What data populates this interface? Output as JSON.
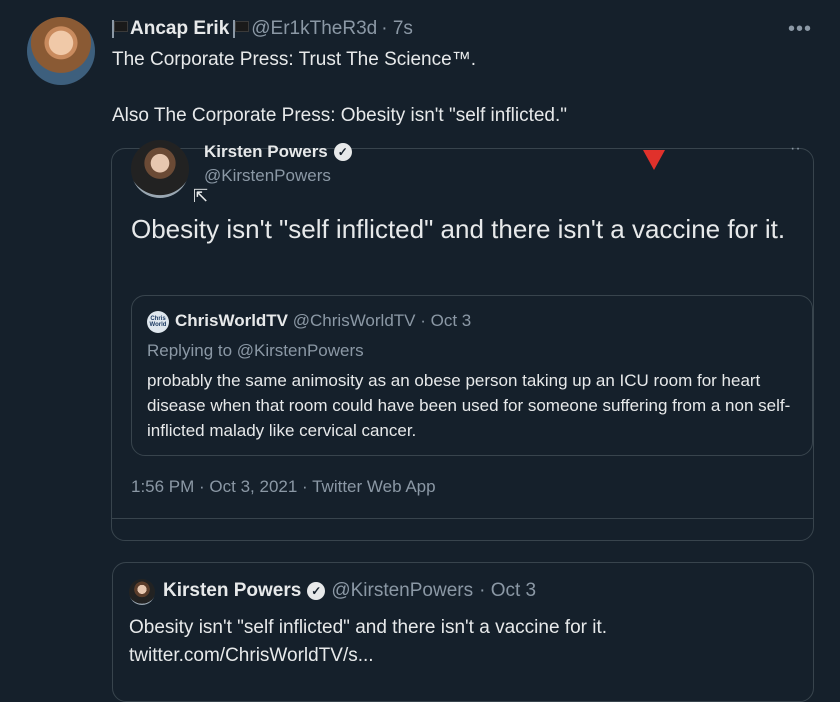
{
  "tweet": {
    "display_name": "Ancap Erik",
    "handle": "@Er1kTheR3d",
    "time": "· 7s",
    "more": "•••",
    "line1": "The Corporate Press: Trust The Science™.",
    "line2": "Also The Corporate Press: Obesity isn't \"self inflicted.\""
  },
  "quoted": {
    "name": "Kirsten Powers",
    "handle": "@KirstenPowers",
    "text": "Obesity isn't \"self inflicted\" and there isn't a vaccine for it.",
    "meta": "1:56 PM · Oct 3, 2021 · Twitter Web App",
    "more": "··"
  },
  "nested": {
    "avatar_text": "Chris World",
    "name": "ChrisWorldTV",
    "handle": "@ChrisWorldTV",
    "time": "· Oct 3",
    "replying": "Replying to @KirstenPowers",
    "text": "probably the same animosity as an obese person taking up an ICU room for heart disease when that room could have been used for someone suffering from a non self-inflicted malady like cervical cancer."
  },
  "bottom_quote": {
    "name": "Kirsten Powers",
    "handle": "@KirstenPowers",
    "time": "· Oct 3",
    "text_line1": "Obesity isn't \"self inflicted\" and there isn't a vaccine for it.",
    "text_line2": "twitter.com/ChrisWorldTV/s..."
  },
  "colors": {
    "background": "#15202b",
    "text": "#e7e9ea",
    "muted": "#8b98a5",
    "border": "#38444d",
    "annotation_arrow": "#e0312b"
  }
}
